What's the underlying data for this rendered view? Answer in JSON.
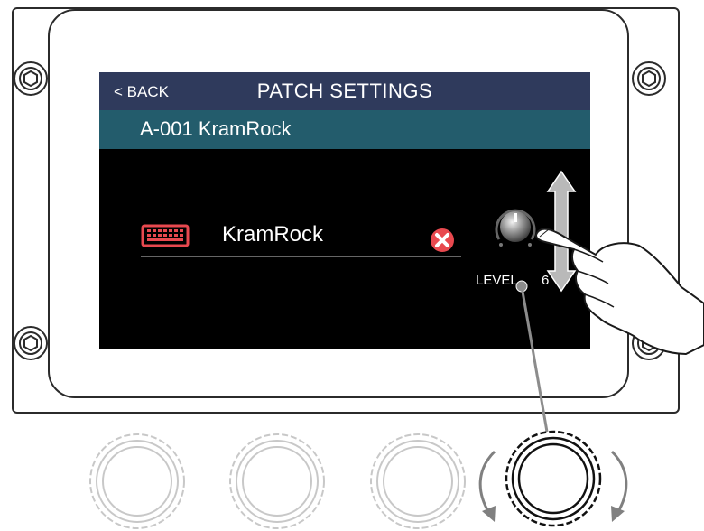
{
  "screen": {
    "back_label": "< BACK",
    "title": "PATCH SETTINGS",
    "patch_label": "A-001 KramRock",
    "name_field": {
      "value": "KramRock",
      "icon": "keyboard-icon"
    },
    "clear_icon": "clear-icon",
    "level": {
      "label": "LEVEL",
      "value": "6"
    }
  },
  "hardware": {
    "knobs": [
      "knob-1",
      "knob-2",
      "knob-3",
      "knob-4"
    ],
    "active_knob": 4
  },
  "colors": {
    "title_bar": "#2f3a5c",
    "patch_bar": "#235c6c",
    "screen_bg": "#000000",
    "accent_red": "#e8494f"
  }
}
